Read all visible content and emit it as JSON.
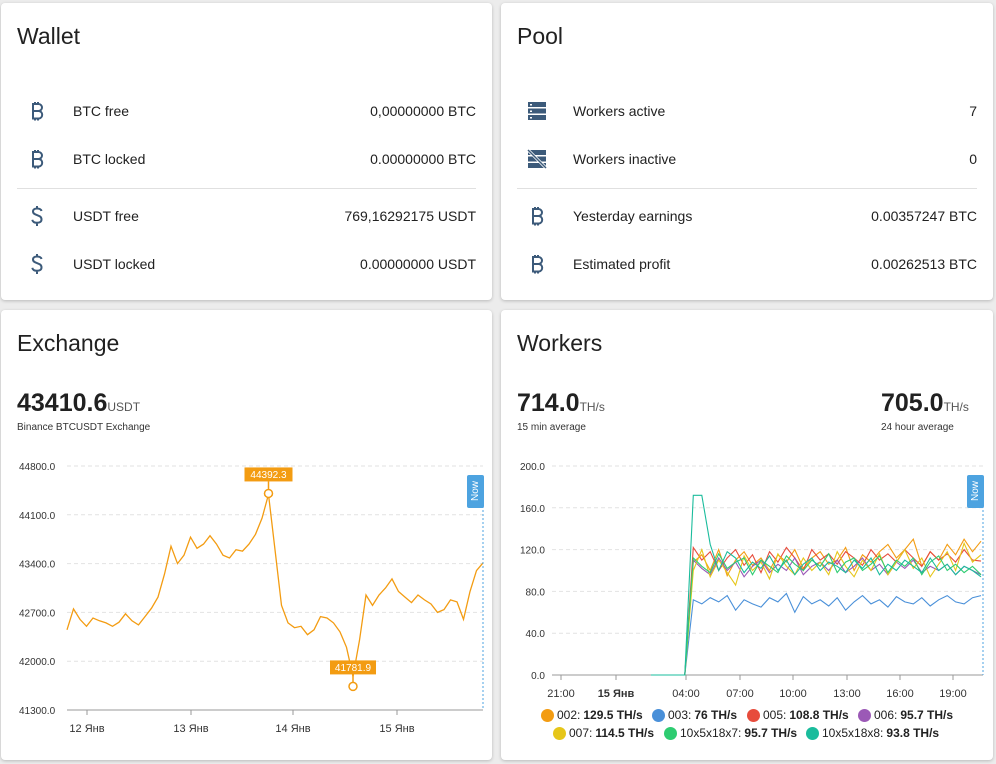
{
  "wallet": {
    "title": "Wallet",
    "rows": [
      {
        "icon": "bitcoin-icon",
        "label": "BTC free",
        "value": "0,00000000 BTC"
      },
      {
        "icon": "bitcoin-icon",
        "label": "BTC locked",
        "value": "0.00000000 BTC"
      },
      {
        "icon": "dollar-icon",
        "label": "USDT free",
        "value": "769,16292175 USDT"
      },
      {
        "icon": "dollar-icon",
        "label": "USDT locked",
        "value": "0.00000000 USDT"
      }
    ]
  },
  "pool": {
    "title": "Pool",
    "rows": [
      {
        "icon": "server-icon",
        "label": "Workers active",
        "value": "7"
      },
      {
        "icon": "server-off-icon",
        "label": "Workers inactive",
        "value": "0"
      },
      {
        "icon": "bitcoin-icon",
        "label": "Yesterday earnings",
        "value": "0.00357247 BTC"
      },
      {
        "icon": "bitcoin-icon",
        "label": "Estimated profit",
        "value": "0.00262513 BTC"
      }
    ]
  },
  "exchange": {
    "title": "Exchange",
    "price": "43410.6",
    "unit": "USDT",
    "subtitle": "Binance BTCUSDT Exchange",
    "now_label": "Now",
    "max_marker": "44392.3",
    "min_marker": "41781.9",
    "colors": {
      "line": "#f39c12",
      "marker": "#f39c12",
      "now": "#4da3e0"
    }
  },
  "workers": {
    "title": "Workers",
    "avg15": {
      "value": "714.0",
      "unit": "TH/s",
      "label": "15 min average"
    },
    "avg24": {
      "value": "705.0",
      "unit": "TH/s",
      "label": "24 hour average"
    },
    "now_label": "Now",
    "legend": [
      {
        "name": "002:",
        "value": "129.5 TH/s",
        "color": "#f39c12"
      },
      {
        "name": "003:",
        "value": "76 TH/s",
        "color": "#4a90d9"
      },
      {
        "name": "005:",
        "value": "108.8 TH/s",
        "color": "#e74c3c"
      },
      {
        "name": "006:",
        "value": "95.7 TH/s",
        "color": "#9b59b6"
      },
      {
        "name": "007:",
        "value": "114.5 TH/s",
        "color": "#e6c619"
      },
      {
        "name": "10x5x18x7:",
        "value": "95.7 TH/s",
        "color": "#2ecc71"
      },
      {
        "name": "10x5x18x8:",
        "value": "93.8 TH/s",
        "color": "#1abc9c"
      }
    ]
  },
  "chart_data": [
    {
      "type": "line",
      "x_ticks": [
        "12 Янв",
        "13 Янв",
        "14 Янв",
        "15 Янв"
      ],
      "y_ticks": [
        "41300.0",
        "42000.0",
        "42700.0",
        "43400.0",
        "44100.0",
        "44800.0"
      ],
      "ylim": [
        41300,
        44800
      ],
      "grid": true,
      "series": [
        {
          "values": [
            42450,
            42750,
            42600,
            42500,
            42620,
            42580,
            42550,
            42500,
            42560,
            42680,
            42580,
            42520,
            42640,
            42760,
            42920,
            43250,
            43650,
            43400,
            43520,
            43780,
            43620,
            43680,
            43800,
            43680,
            43520,
            43480,
            43600,
            43580,
            43680,
            43820,
            44050,
            44392,
            43600,
            42800,
            42550,
            42480,
            42500,
            42380,
            42450,
            42640,
            42620,
            42550,
            42420,
            42200,
            41782,
            42300,
            42950,
            42800,
            42950,
            43050,
            43180,
            43000,
            42920,
            42840,
            42950,
            42880,
            42820,
            42700,
            42740,
            42880,
            42850,
            42600,
            43000,
            43300,
            43410
          ]
        }
      ],
      "annotations": [
        {
          "label": "44392.3",
          "kind": "max"
        },
        {
          "label": "41781.9",
          "kind": "min"
        }
      ]
    },
    {
      "type": "line",
      "x_ticks": [
        "21:00",
        "15 Янв",
        "04:00",
        "07:00",
        "10:00",
        "13:00",
        "16:00",
        "19:00"
      ],
      "y_ticks": [
        "0.0",
        "40.0",
        "80.0",
        "120.0",
        "160.0",
        "200.0"
      ],
      "ylim": [
        0,
        200
      ],
      "grid": true,
      "series": [
        {
          "name": "002:",
          "values": [
            0,
            0,
            0,
            0,
            0,
            108,
            115,
            100,
            120,
            95,
            110,
            118,
            105,
            112,
            100,
            115,
            108,
            120,
            102,
            112,
            118,
            106,
            110,
            122,
            100,
            115,
            108,
            118,
            125,
            112,
            120,
            130,
            104,
            118,
            110,
            125,
            115,
            130,
            118,
            128
          ]
        },
        {
          "name": "003:",
          "values": [
            0,
            0,
            0,
            0,
            0,
            72,
            68,
            74,
            70,
            76,
            62,
            72,
            68,
            65,
            74,
            70,
            78,
            60,
            75,
            68,
            72,
            66,
            74,
            62,
            70,
            76,
            68,
            72,
            65,
            75,
            70,
            68,
            74,
            66,
            72,
            76,
            70,
            68,
            74,
            76
          ]
        },
        {
          "name": "005:",
          "values": [
            0,
            0,
            0,
            0,
            0,
            122,
            110,
            118,
            100,
            112,
            120,
            105,
            115,
            98,
            118,
            108,
            122,
            112,
            100,
            120,
            110,
            116,
            106,
            118,
            112,
            105,
            120,
            110,
            116,
            108,
            120,
            112,
            104,
            118,
            110,
            116,
            108,
            120,
            110,
            109
          ]
        },
        {
          "name": "006:",
          "values": [
            0,
            0,
            0,
            0,
            0,
            110,
            102,
            96,
            112,
            100,
            108,
            94,
            104,
            110,
            98,
            106,
            100,
            112,
            96,
            104,
            108,
            100,
            110,
            98,
            104,
            112,
            100,
            106,
            96,
            108,
            102,
            110,
            98,
            104,
            100,
            106,
            96,
            104,
            100,
            96
          ]
        },
        {
          "name": "007:",
          "values": [
            0,
            0,
            0,
            0,
            0,
            100,
            120,
            94,
            110,
            98,
            86,
            114,
            100,
            108,
            92,
            116,
            104,
            96,
            112,
            100,
            108,
            96,
            118,
            104,
            94,
            110,
            100,
            116,
            96,
            108,
            120,
            102,
            112,
            94,
            106,
            118,
            100,
            126,
            108,
            115
          ]
        },
        {
          "name": "10x5x18x7:",
          "values": [
            0,
            0,
            0,
            0,
            0,
            112,
            104,
            98,
            116,
            102,
            108,
            112,
            96,
            110,
            104,
            98,
            114,
            106,
            100,
            110,
            104,
            116,
            98,
            108,
            112,
            100,
            106,
            114,
            98,
            110,
            104,
            112,
            96,
            108,
            114,
            100,
            106,
            98,
            104,
            96
          ]
        },
        {
          "name": "10x5x18x8:",
          "values": [
            0,
            0,
            0,
            0,
            0,
            172,
            172,
            125,
            100,
            118,
            112,
            98,
            108,
            102,
            114,
            100,
            110,
            96,
            106,
            112,
            100,
            108,
            104,
            98,
            110,
            102,
            112,
            96,
            106,
            100,
            110,
            104,
            98,
            112,
            100,
            106,
            96,
            104,
            100,
            94
          ]
        }
      ]
    }
  ]
}
